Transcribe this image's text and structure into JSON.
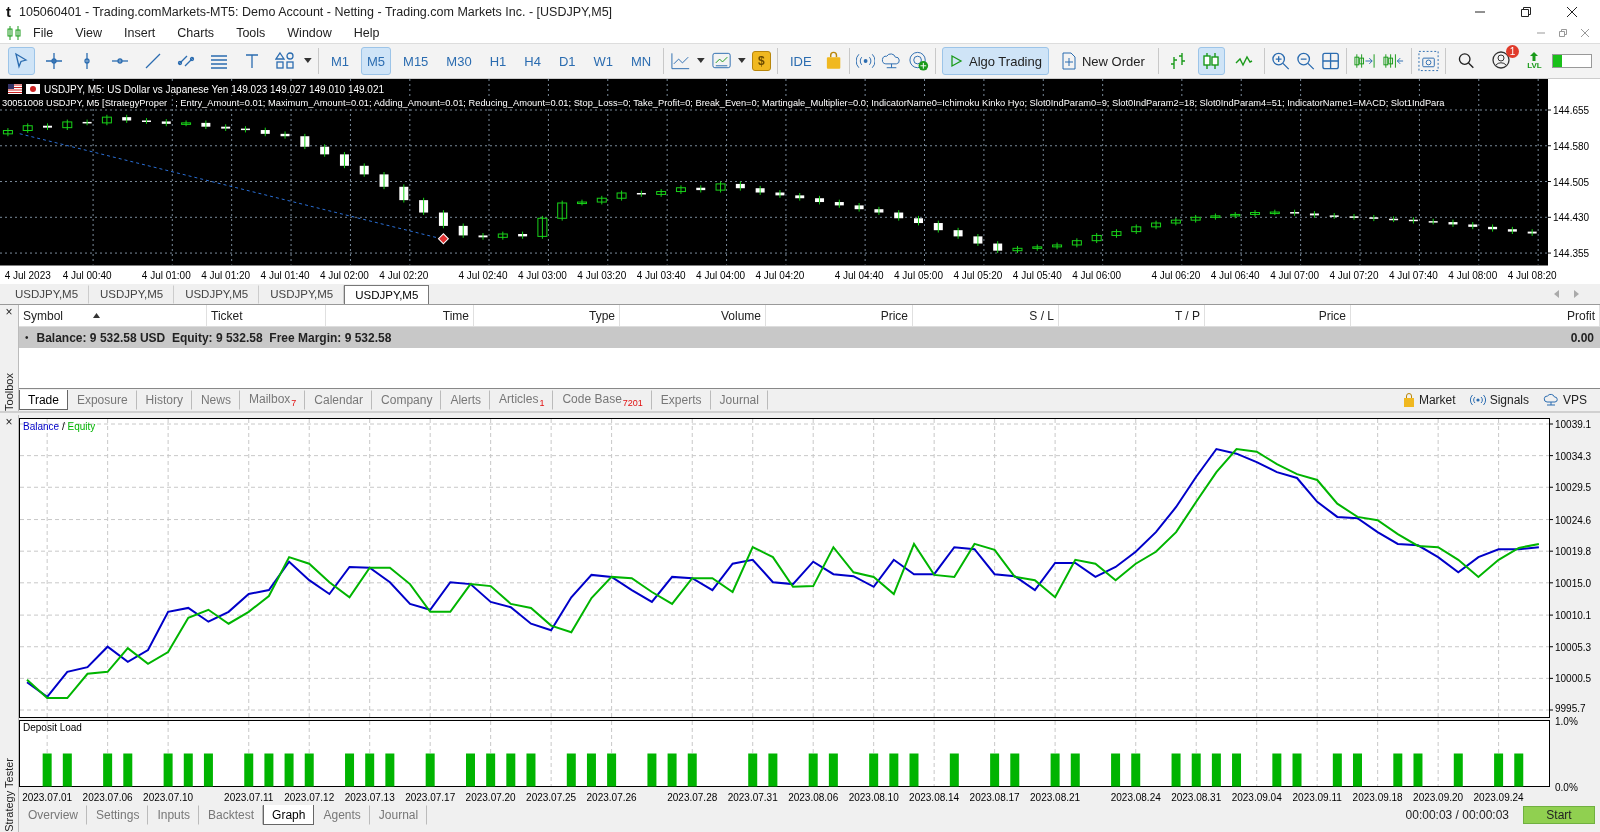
{
  "window": {
    "logo": "t",
    "title": "105060401 - Trading.comMarkets-MT5: Demo Account - Netting - Trading.com Markets Inc. - [USDJPY,M5]"
  },
  "menu": [
    "File",
    "View",
    "Insert",
    "Charts",
    "Tools",
    "Window",
    "Help"
  ],
  "toolbar": {
    "tools": [
      {
        "kind": "cursor",
        "selected": true
      },
      {
        "kind": "crosshair",
        "selected": false
      },
      {
        "kind": "vline",
        "selected": false
      },
      {
        "kind": "hline",
        "selected": false
      },
      {
        "kind": "trendline",
        "selected": false
      },
      {
        "kind": "channel",
        "selected": false
      },
      {
        "kind": "levels",
        "selected": false
      },
      {
        "kind": "text",
        "selected": false
      },
      {
        "kind": "shapes",
        "selected": false
      }
    ],
    "timeframes": [
      {
        "label": "M1",
        "selected": false
      },
      {
        "label": "M5",
        "selected": true
      },
      {
        "label": "M15",
        "selected": false
      },
      {
        "label": "M30",
        "selected": false
      },
      {
        "label": "H1",
        "selected": false
      },
      {
        "label": "H4",
        "selected": false
      },
      {
        "label": "D1",
        "selected": false
      },
      {
        "label": "W1",
        "selected": false
      },
      {
        "label": "MN",
        "selected": false
      }
    ],
    "dollar": "$",
    "ide": "IDE",
    "algo_trading": {
      "label": "Algo Trading",
      "selected": true
    },
    "new_order": "New Order",
    "chart_types": [
      {
        "kind": "bars",
        "selected": false
      },
      {
        "kind": "candles",
        "selected": true
      },
      {
        "kind": "line",
        "selected": false
      }
    ],
    "notifications": "1",
    "lvl": "LVL"
  },
  "price_chart": {
    "symbol_line": "USDJPY, M5:  US Dollar vs Japanese Yen  149.023 149.027 149.010 149.021",
    "strategy_line": "30051008 USDJPY, M5 [StrategyProper",
    "parameters_line": "; Entry_Amount=0.01; Maximum_Amount=0.01; Adding_Amount=0.01; Reducing_Amount=0.01; Stop_Loss=0; Take_Profit=0; Break_Even=0; Martingale_Multiplier=0.0; IndicatorName0=Ichimoku Kinko Hyo; Slot0IndParam0=9; Slot0IndParam2=18; Slot0IndParam4=51; IndicatorName1=MACD; Slot1IndPara",
    "chart_data": {
      "type": "candlestick",
      "grid": true,
      "ylim": [
        144.33,
        144.72
      ],
      "categories": [
        null,
        "4 Jul 2023",
        null,
        null,
        "4 Jul 00:40",
        null,
        null,
        null,
        "4 Jul 01:00",
        null,
        null,
        "4 Jul 01:20",
        null,
        null,
        "4 Jul 01:40",
        null,
        null,
        "4 Jul 02:00",
        null,
        null,
        "4 Jul 02:20",
        null,
        null,
        null,
        "4 Jul 02:40",
        null,
        null,
        "4 Jul 03:00",
        null,
        null,
        "4 Jul 03:20",
        null,
        null,
        "4 Jul 03:40",
        null,
        null,
        "4 Jul 04:00",
        null,
        null,
        "4 Jul 04:20",
        null,
        null,
        null,
        "4 Jul 04:40",
        null,
        null,
        "4 Jul 05:00",
        null,
        null,
        "4 Jul 05:20",
        null,
        null,
        "4 Jul 05:40",
        null,
        null,
        "4 Jul 06:00",
        null,
        null,
        null,
        "4 Jul 06:20",
        null,
        null,
        "4 Jul 06:40",
        null,
        null,
        "4 Jul 07:00",
        null,
        null,
        "4 Jul 07:20",
        null,
        null,
        "4 Jul 07:40",
        null,
        null,
        "4 Jul 08:00",
        null,
        null,
        "4 Jul 08:20"
      ],
      "ohlc": [
        [
          144.605,
          144.617,
          144.6,
          144.612
        ],
        [
          144.612,
          144.627,
          144.607,
          144.622
        ],
        [
          144.622,
          144.627,
          144.613,
          144.618
        ],
        [
          144.618,
          144.635,
          144.613,
          144.63
        ],
        [
          144.63,
          144.635,
          144.623,
          144.628
        ],
        [
          144.628,
          144.645,
          144.623,
          144.64
        ],
        [
          144.64,
          144.645,
          144.628,
          144.633
        ],
        [
          144.633,
          144.638,
          144.626,
          144.631
        ],
        [
          144.631,
          144.636,
          144.621,
          144.626
        ],
        [
          144.626,
          144.633,
          144.621,
          144.628
        ],
        [
          144.628,
          144.633,
          144.615,
          144.62
        ],
        [
          144.62,
          144.625,
          144.611,
          144.616
        ],
        [
          144.616,
          144.621,
          144.608,
          144.613
        ],
        [
          144.613,
          144.618,
          144.6,
          144.605
        ],
        [
          144.605,
          144.61,
          144.595,
          144.6
        ],
        [
          144.6,
          144.605,
          144.573,
          144.578
        ],
        [
          144.578,
          144.583,
          144.557,
          144.562
        ],
        [
          144.562,
          144.567,
          144.533,
          144.538
        ],
        [
          144.538,
          144.543,
          144.515,
          144.52
        ],
        [
          144.52,
          144.525,
          144.489,
          144.494
        ],
        [
          144.494,
          144.499,
          144.461,
          144.466
        ],
        [
          144.466,
          144.471,
          144.435,
          144.44
        ],
        [
          144.44,
          144.445,
          144.407,
          144.412
        ],
        [
          144.412,
          144.417,
          144.387,
          144.392
        ],
        [
          144.392,
          144.397,
          144.383,
          144.388
        ],
        [
          144.388,
          144.4,
          144.383,
          144.395
        ],
        [
          144.395,
          144.4,
          144.385,
          144.39
        ],
        [
          144.39,
          144.433,
          144.385,
          144.428
        ],
        [
          144.428,
          144.465,
          144.423,
          144.46
        ],
        [
          144.46,
          144.467,
          144.455,
          144.462
        ],
        [
          144.462,
          144.475,
          144.457,
          144.47
        ],
        [
          144.47,
          144.486,
          144.465,
          144.481
        ],
        [
          144.481,
          144.486,
          144.473,
          144.478
        ],
        [
          144.478,
          144.489,
          144.473,
          144.484
        ],
        [
          144.484,
          144.497,
          144.479,
          144.492
        ],
        [
          144.492,
          144.497,
          144.482,
          144.487
        ],
        [
          144.487,
          144.505,
          144.482,
          144.5
        ],
        [
          144.5,
          144.505,
          144.486,
          144.491
        ],
        [
          144.491,
          144.496,
          144.477,
          144.482
        ],
        [
          144.482,
          144.487,
          144.471,
          144.476
        ],
        [
          144.476,
          144.481,
          144.465,
          144.47
        ],
        [
          144.47,
          144.475,
          144.457,
          144.462
        ],
        [
          144.462,
          144.467,
          144.45,
          144.455
        ],
        [
          144.455,
          144.46,
          144.442,
          144.447
        ],
        [
          144.447,
          144.452,
          144.435,
          144.44
        ],
        [
          144.44,
          144.445,
          144.423,
          144.428
        ],
        [
          144.428,
          144.433,
          144.413,
          144.418
        ],
        [
          144.418,
          144.423,
          144.398,
          144.403
        ],
        [
          144.403,
          144.408,
          144.385,
          144.39
        ],
        [
          144.39,
          144.395,
          144.37,
          144.375
        ],
        [
          144.375,
          144.38,
          144.355,
          144.36
        ],
        [
          144.36,
          144.37,
          144.355,
          144.365
        ],
        [
          144.365,
          144.373,
          144.36,
          144.368
        ],
        [
          144.368,
          144.377,
          144.363,
          144.372
        ],
        [
          144.372,
          144.386,
          144.367,
          144.381
        ],
        [
          144.381,
          144.397,
          144.376,
          144.392
        ],
        [
          144.392,
          144.405,
          144.387,
          144.4
        ],
        [
          144.4,
          144.415,
          144.395,
          144.41
        ],
        [
          144.41,
          144.423,
          144.405,
          144.418
        ],
        [
          144.418,
          144.429,
          144.413,
          144.424
        ],
        [
          144.424,
          144.435,
          144.419,
          144.43
        ],
        [
          144.43,
          144.438,
          144.425,
          144.433
        ],
        [
          144.433,
          144.441,
          144.428,
          144.436
        ],
        [
          144.436,
          144.445,
          144.431,
          144.44
        ],
        [
          144.44,
          144.446,
          144.435,
          144.441
        ],
        [
          144.441,
          144.446,
          144.433,
          144.438
        ],
        [
          144.438,
          144.443,
          144.429,
          144.434
        ],
        [
          144.434,
          144.439,
          144.427,
          144.432
        ],
        [
          144.432,
          144.437,
          144.425,
          144.43
        ],
        [
          144.43,
          144.435,
          144.422,
          144.427
        ],
        [
          144.427,
          144.432,
          144.42,
          144.425
        ],
        [
          144.425,
          144.43,
          144.417,
          144.422
        ],
        [
          144.422,
          144.427,
          144.415,
          144.42
        ],
        [
          144.42,
          144.425,
          144.41,
          144.415
        ],
        [
          144.415,
          144.42,
          144.405,
          144.41
        ],
        [
          144.41,
          144.415,
          144.4,
          144.405
        ],
        [
          144.405,
          144.41,
          144.395,
          144.4
        ],
        [
          144.4,
          144.405,
          144.391,
          144.396
        ]
      ],
      "yticks": [
        {
          "value": 144.655,
          "label": "144.655"
        },
        {
          "value": 144.58,
          "label": "144.580"
        },
        {
          "value": 144.505,
          "label": "144.505"
        },
        {
          "value": 144.43,
          "label": "144.430"
        },
        {
          "value": 144.355,
          "label": "144.355"
        }
      ]
    }
  },
  "chart_tabs": [
    {
      "label": "USDJPY,M5",
      "selected": false
    },
    {
      "label": "USDJPY,M5",
      "selected": false
    },
    {
      "label": "USDJPY,M5",
      "selected": false
    },
    {
      "label": "USDJPY,M5",
      "selected": false
    },
    {
      "label": "USDJPY,M5",
      "selected": true
    }
  ],
  "toolbox": {
    "side_label": "Toolbox",
    "close": "×",
    "columns": [
      "Symbol",
      "Ticket",
      "Time",
      "Type",
      "Volume",
      "Price",
      "S / L",
      "T / P",
      "Price",
      "Profit"
    ],
    "balance_row": {
      "bullet": "•",
      "text": "Balance: 9 532.58 USD  Equity: 9 532.58  Free Margin: 9 532.58",
      "profit": "0.00"
    },
    "tabs": [
      {
        "label": "Trade",
        "selected": true
      },
      {
        "label": "Exposure",
        "selected": false
      },
      {
        "label": "History",
        "selected": false
      },
      {
        "label": "News",
        "selected": false
      },
      {
        "label": "Mailbox",
        "badge": "7",
        "selected": false
      },
      {
        "label": "Calendar",
        "selected": false
      },
      {
        "label": "Company",
        "selected": false
      },
      {
        "label": "Alerts",
        "selected": false
      },
      {
        "label": "Articles",
        "badge": "1",
        "selected": false
      },
      {
        "label": "Code Base",
        "badge": "7201",
        "selected": false
      },
      {
        "label": "Experts",
        "selected": false
      },
      {
        "label": "Journal",
        "selected": false
      }
    ],
    "links": [
      {
        "kind": "market",
        "label": "Market"
      },
      {
        "kind": "signals",
        "label": "Signals"
      },
      {
        "kind": "vps",
        "label": "VPS"
      }
    ]
  },
  "strategy_tester": {
    "side_label": "Strategy Tester",
    "close": "×",
    "balance_chart": {
      "legend_separator": "/",
      "chart_data": {
        "type": "line",
        "grid": true,
        "ylim": [
          9995.7,
          10039.1
        ],
        "yticks": [
          {
            "value": 10039.1,
            "label": "10039.1"
          },
          {
            "value": 10034.3,
            "label": "10034.3"
          },
          {
            "value": 10029.5,
            "label": "10029.5"
          },
          {
            "value": 10024.6,
            "label": "10024.6"
          },
          {
            "value": 10019.8,
            "label": "10019.8"
          },
          {
            "value": 10015.0,
            "label": "10015.0"
          },
          {
            "value": 10010.1,
            "label": "10010.1"
          },
          {
            "value": 10005.3,
            "label": "10005.3"
          },
          {
            "value": 10000.5,
            "label": "10000.5"
          },
          {
            "value": 9995.7,
            "label": "9995.7"
          }
        ],
        "series": [
          {
            "name": "Balance",
            "color": "#0000c8",
            "values": [
              9999.9,
              9997.7,
              10001.5,
              10002.2,
              10005.3,
              10003.0,
              10004.8,
              10010.6,
              10011.2,
              10009.1,
              10010.6,
              10013.3,
              10013.9,
              10018.2,
              10015.4,
              10013.3,
              10017.4,
              10017.3,
              10015.1,
              10011.8,
              10010.9,
              10015.1,
              10014.8,
              10012.1,
              10011.3,
              10008.8,
              10007.8,
              10012.8,
              10016.2,
              10015.9,
              10013.9,
              10012.1,
              10015.9,
              10015.7,
              10013.9,
              10017.9,
              10018.5,
              10015.1,
              10014.8,
              10018.2,
              10016.3,
              10016.0,
              10014.4,
              10018.5,
              10016.3,
              10016.3,
              10020.4,
              10020.1,
              10016.3,
              10016.0,
              10013.9,
              10018.0,
              10018.0,
              10015.9,
              10017.4,
              10019.7,
              10022.7,
              10026.5,
              10031.1,
              10035.3,
              10034.6,
              10033.3,
              10031.8,
              10030.9,
              10027.3,
              10025.0,
              10024.8,
              10022.7,
              10020.9,
              10020.7,
              10018.9,
              10016.6,
              10018.9,
              10020.1,
              10020.1,
              10020.4
            ]
          },
          {
            "name": "Equity",
            "color": "#00b400",
            "values": [
              10000.3,
              9997.5,
              9997.5,
              10001.2,
              10001.5,
              10005.1,
              10002.7,
              10004.5,
              10009.7,
              10010.9,
              10008.8,
              10010.6,
              10013.0,
              10018.9,
              10017.9,
              10015.1,
              10012.8,
              10017.3,
              10017.3,
              10014.8,
              10010.6,
              10010.6,
              10014.8,
              10014.5,
              10011.8,
              10011.2,
              10008.5,
              10007.5,
              10012.7,
              10015.9,
              10015.7,
              10013.6,
              10011.8,
              10015.7,
              10015.7,
              10013.6,
              10020.4,
              10018.9,
              10014.4,
              10014.5,
              10020.4,
              10016.6,
              10015.9,
              10013.3,
              10020.9,
              10016.2,
              10015.9,
              10020.9,
              10020.0,
              10015.9,
              10015.4,
              10012.8,
              10018.5,
              10017.9,
              10015.4,
              10017.9,
              10019.7,
              10022.7,
              10027.3,
              10031.8,
              10035.3,
              10034.9,
              10033.0,
              10031.5,
              10030.6,
              10027.0,
              10025.0,
              10024.5,
              10022.4,
              10020.6,
              10020.4,
              10018.5,
              10015.9,
              10018.5,
              10020.3,
              10020.9
            ]
          }
        ]
      }
    },
    "deposit_chart": {
      "chart_data": {
        "type": "bar",
        "title": "Deposit Load",
        "grid": true,
        "ylim": [
          0,
          1
        ],
        "categories": [
          null,
          "2023.07.01",
          null,
          null,
          "2023.07.06",
          null,
          null,
          "2023.07.10",
          null,
          null,
          null,
          "2023.07.11",
          null,
          null,
          "2023.07.12",
          null,
          null,
          "2023.07.13",
          null,
          null,
          "2023.07.17",
          null,
          null,
          "2023.07.20",
          null,
          null,
          "2023.07.25",
          null,
          null,
          "2023.07.26",
          null,
          null,
          null,
          "2023.07.28",
          null,
          null,
          "2023.07.31",
          null,
          null,
          "2023.08.06",
          null,
          null,
          "2023.08.10",
          null,
          null,
          "2023.08.14",
          null,
          null,
          "2023.08.17",
          null,
          null,
          "2023.08.21",
          null,
          null,
          null,
          "2023.08.24",
          null,
          null,
          "2023.08.31",
          null,
          null,
          "2023.09.04",
          null,
          null,
          "2023.09.11",
          null,
          null,
          "2023.09.18",
          null,
          null,
          "2023.09.20",
          null,
          null,
          "2023.09.24",
          null,
          null
        ],
        "series": [
          {
            "color": "#00b400",
            "values": [
              0,
              0.5,
              0.5,
              0,
              0.5,
              0.5,
              0,
              0.5,
              0.5,
              0.5,
              0,
              0.5,
              0.5,
              0.5,
              0.5,
              0,
              0.5,
              0.5,
              0.5,
              0,
              0.5,
              0,
              0.5,
              0.5,
              0.5,
              0.5,
              0,
              0.5,
              0.5,
              0.5,
              0,
              0.5,
              0.5,
              0.5,
              0,
              0,
              0.5,
              0.5,
              0,
              0.5,
              0.5,
              0,
              0.5,
              0.5,
              0.5,
              0,
              0.5,
              0,
              0.5,
              0.5,
              0,
              0.5,
              0.5,
              0,
              0.5,
              0.5,
              0,
              0.5,
              0.5,
              0.5,
              0.5,
              0,
              0.5,
              0.5,
              0,
              0.5,
              0.5,
              0,
              0.5,
              0.5,
              0,
              0.5,
              0,
              0.5,
              0.5,
              0
            ]
          }
        ],
        "yticks": [
          {
            "value": 1,
            "label": "1.0%"
          },
          {
            "value": 0,
            "label": "0.0%"
          }
        ]
      }
    },
    "tabs": [
      {
        "label": "Overview",
        "selected": false
      },
      {
        "label": "Settings",
        "selected": false
      },
      {
        "label": "Inputs",
        "selected": false
      },
      {
        "label": "Backtest",
        "selected": false
      },
      {
        "label": "Graph",
        "selected": true
      },
      {
        "label": "Agents",
        "selected": false
      },
      {
        "label": "Journal",
        "selected": false
      }
    ],
    "elapsed": "00:00:03 / 00:00:03",
    "start": "Start"
  }
}
